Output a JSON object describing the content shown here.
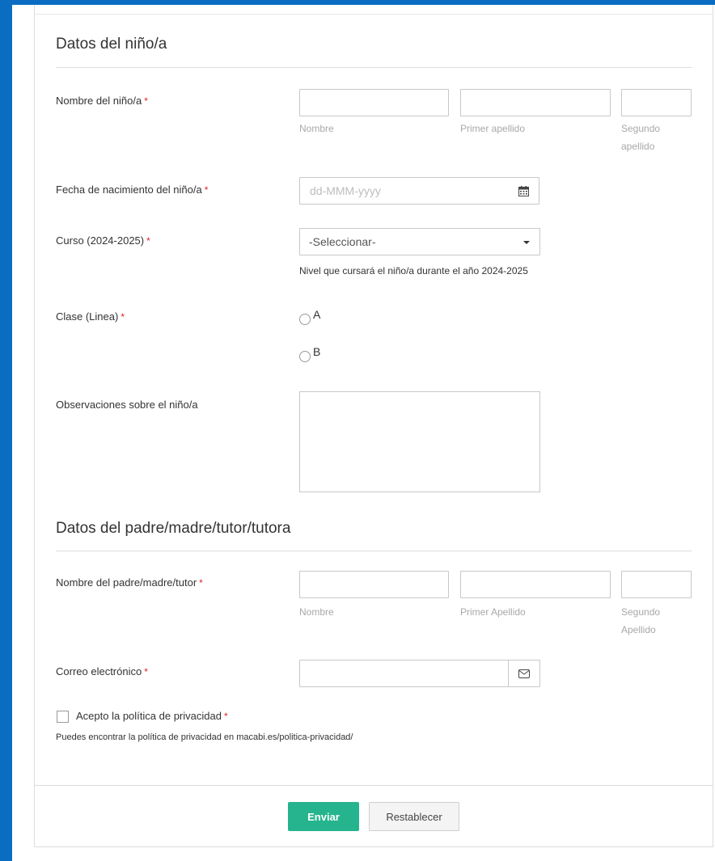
{
  "form": {
    "child_section": {
      "title": "Datos del niño/a",
      "name_label": "Nombre del niño/a",
      "name_sub": {
        "first": "Nombre",
        "last1": "Primer apellido",
        "last2_line1": "Segundo",
        "last2_line2": "apellido"
      },
      "birth_label": "Fecha de nacimiento del niño/a",
      "birth_placeholder": "dd-MMM-yyyy",
      "course_label": "Curso (2024-2025)",
      "course_selected": "-Seleccionar-",
      "course_help": "Nivel que cursará el niño/a durante el año 2024-2025",
      "class_label": "Clase (Linea)",
      "class_options": [
        "A",
        "B"
      ],
      "notes_label": "Observaciones sobre el niño/a"
    },
    "parent_section": {
      "title": "Datos del padre/madre/tutor/tutora",
      "name_label": "Nombre del padre/madre/tutor",
      "name_sub": {
        "first": "Nombre",
        "last1": "Primer Apellido",
        "last2_line1": "Segundo",
        "last2_line2": "Apellido"
      },
      "email_label": "Correo electrónico"
    },
    "privacy": {
      "checkbox_label": "Acepto la política de privacidad",
      "note": "Puedes encontrar la política de privacidad en macabi.es/politica-privacidad/"
    },
    "required_mark": "*",
    "buttons": {
      "submit": "Enviar",
      "reset": "Restablecer"
    }
  },
  "icons": {
    "date": "calendar-icon",
    "email": "envelope-icon",
    "select": "caret-down-icon"
  },
  "colors": {
    "brand_blue": "#0a6dc2",
    "submit_green": "#26b48e",
    "required_red": "#e02424"
  }
}
